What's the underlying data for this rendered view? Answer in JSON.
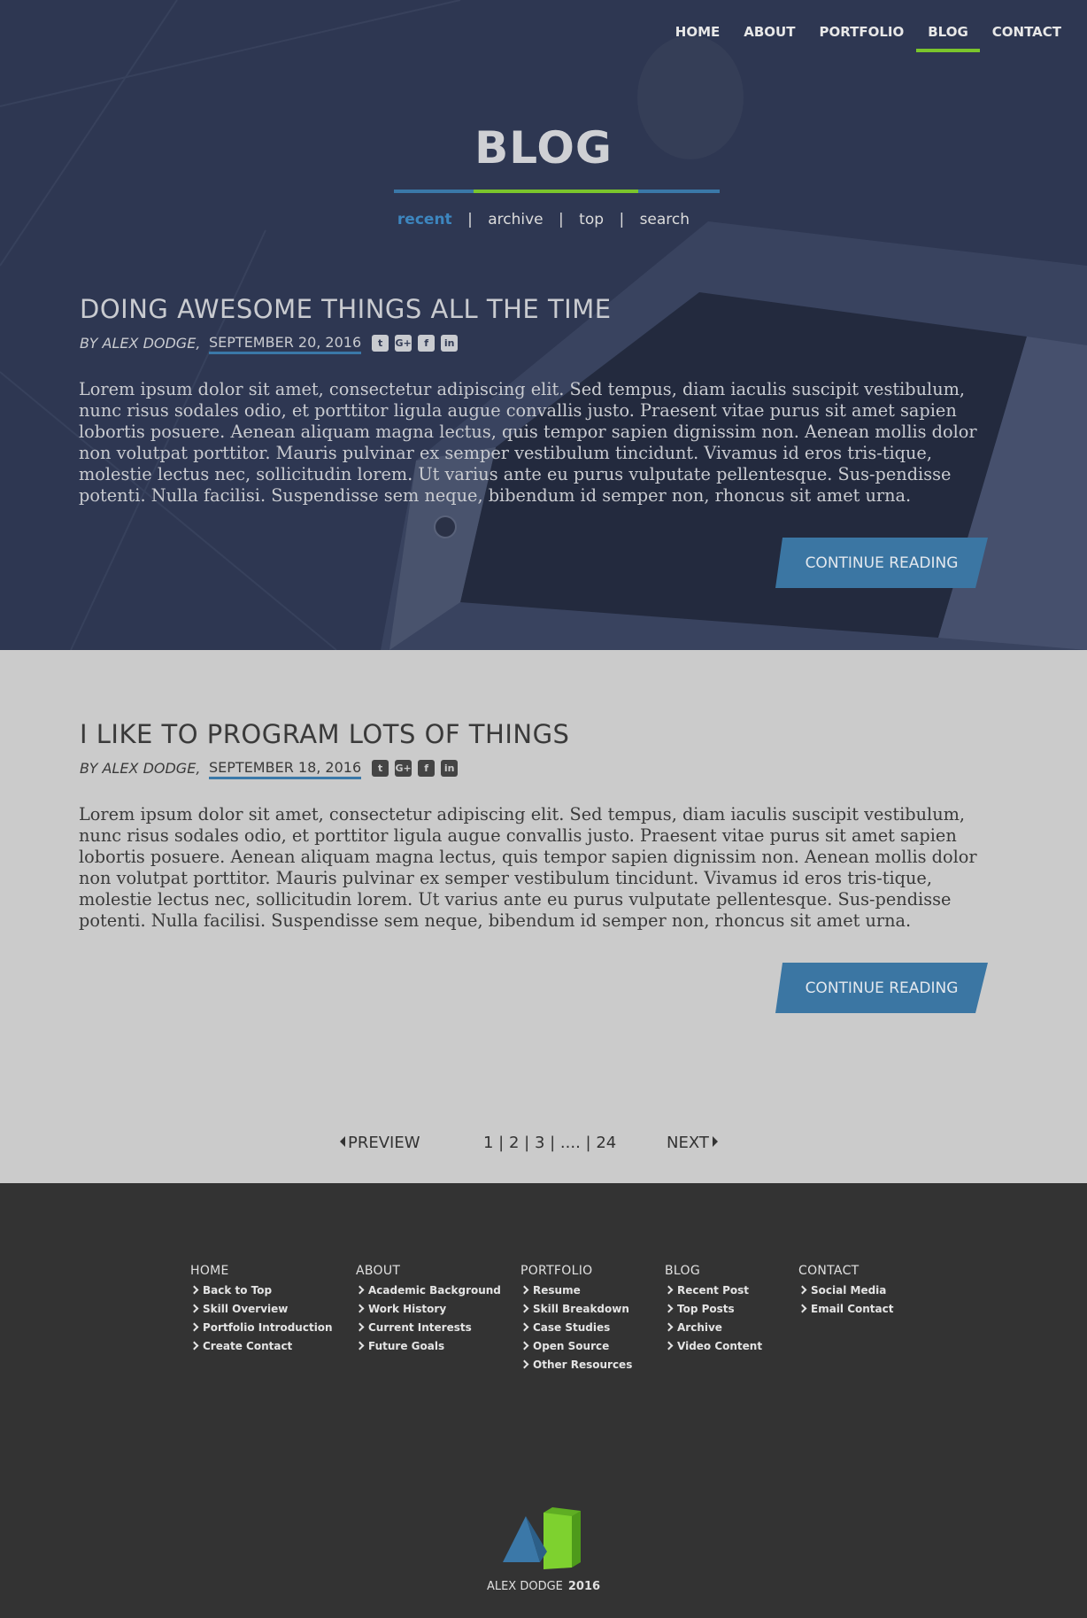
{
  "nav": {
    "items": [
      "HOME",
      "ABOUT",
      "PORTFOLIO",
      "BLOG",
      "CONTACT"
    ],
    "active": "BLOG"
  },
  "hero": {
    "title": "BLOG",
    "subnav": [
      "recent",
      "archive",
      "top",
      "search"
    ],
    "separator": "|",
    "active_subnav": "recent"
  },
  "posts": [
    {
      "title": "DOING AWESOME THINGS ALL THE TIME",
      "author": "BY ALEX DODGE,",
      "date": "SEPTEMBER 20, 2016",
      "body": "Lorem ipsum dolor sit amet, consectetur adipiscing elit. Sed tempus, diam iaculis suscipit vestibulum, nunc risus sodales odio, et porttitor ligula augue convallis justo. Praesent vitae purus sit amet sapien lobortis posuere. Aenean aliquam magna lectus, quis tempor sapien dignissim non. Aenean mollis dolor non volutpat porttitor. Mauris pulvinar ex semper vestibulum tincidunt. Vivamus id eros tris-tique, molestie lectus nec, sollicitudin lorem. Ut varius ante eu purus vulputate pellentesque. Sus-pendisse potenti. Nulla facilisi. Suspendisse sem neque, bibendum id semper non, rhoncus sit amet urna.",
      "cta": "CONTINUE READING"
    },
    {
      "title": "I LIKE TO PROGRAM LOTS OF THINGS",
      "author": "BY ALEX DODGE,",
      "date": "SEPTEMBER 18, 2016",
      "body": "Lorem ipsum dolor sit amet, consectetur adipiscing elit. Sed tempus, diam iaculis suscipit vestibulum, nunc risus sodales odio, et porttitor ligula augue convallis justo. Praesent vitae purus sit amet sapien lobortis posuere. Aenean aliquam magna lectus, quis tempor sapien dignissim non. Aenean mollis dolor non volutpat porttitor. Mauris pulvinar ex semper vestibulum tincidunt. Vivamus id eros tris-tique, molestie lectus nec, sollicitudin lorem. Ut varius ante eu purus vulputate pellentesque. Sus-pendisse potenti. Nulla facilisi. Suspendisse sem neque, bibendum id semper non, rhoncus sit amet urna.",
      "cta": "CONTINUE READING"
    }
  ],
  "share_icons": [
    "twitter-icon",
    "google-plus-icon",
    "facebook-icon",
    "linkedin-icon"
  ],
  "pager": {
    "prev": "PREVIEW",
    "pages": [
      "1",
      "2",
      "3",
      "....",
      "24"
    ],
    "next": "NEXT"
  },
  "footer": {
    "columns": [
      {
        "title": "HOME",
        "links": [
          "Back to Top",
          "Skill Overview",
          "Portfolio Introduction",
          "Create Contact"
        ]
      },
      {
        "title": "ABOUT",
        "links": [
          "Academic Background",
          "Work History",
          "Current Interests",
          "Future Goals"
        ]
      },
      {
        "title": "PORTFOLIO",
        "links": [
          "Resume",
          "Skill Breakdown",
          "Case Studies",
          "Open Source",
          "Other Resources"
        ]
      },
      {
        "title": "BLOG",
        "links": [
          "Recent Post",
          "Top Posts",
          "Archive",
          "Video Content"
        ]
      },
      {
        "title": "CONTACT",
        "links": [
          "Social Media",
          "Email Contact"
        ]
      }
    ],
    "copyright_name": "ALEX DODGE",
    "copyright_year": "2016"
  },
  "colors": {
    "accent_blue": "#3a78a8",
    "accent_green": "#7ac52c",
    "hero_bg": "#2d3650",
    "gray_bg": "#cbcbcb",
    "footer_bg": "#333333"
  }
}
